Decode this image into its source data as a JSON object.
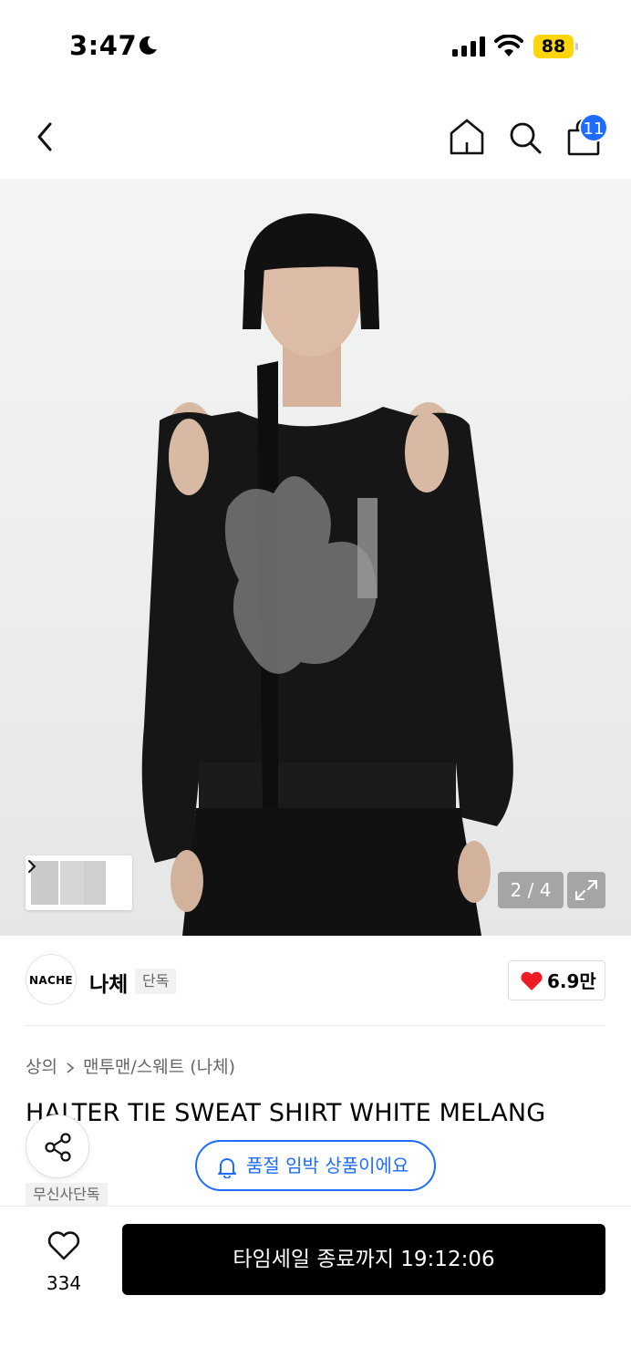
{
  "status_bar": {
    "time": "3:47",
    "battery": "88"
  },
  "header": {
    "cart_count": "11"
  },
  "gallery": {
    "counter": "2 / 4"
  },
  "brand": {
    "logo_text": "NACHE",
    "name": "나체",
    "tag": "단독",
    "likes": "6.9만"
  },
  "breadcrumb": {
    "category": "상의",
    "subcategory": "맨투맨/스웨트 (나체)"
  },
  "product": {
    "title": "HALTER TIE SWEAT SHIRT WHITE MELANG",
    "exclusive_tag": "무신사단독"
  },
  "notice": {
    "soldout_text": "품절 임박 상품이에요"
  },
  "bottom_bar": {
    "wish_count": "334",
    "cta_label": "타임세일 종료까지 19:12:06"
  },
  "colors": {
    "accent_blue": "#1e6cff",
    "battery_yellow": "#ffd60a",
    "heart_red": "#ee1c25"
  },
  "icons": [
    "moon-icon",
    "signal-icon",
    "wifi-icon",
    "back-icon",
    "home-icon",
    "search-icon",
    "cart-icon",
    "chevron-right-icon",
    "expand-icon",
    "heart-icon",
    "share-icon",
    "bell-icon"
  ]
}
